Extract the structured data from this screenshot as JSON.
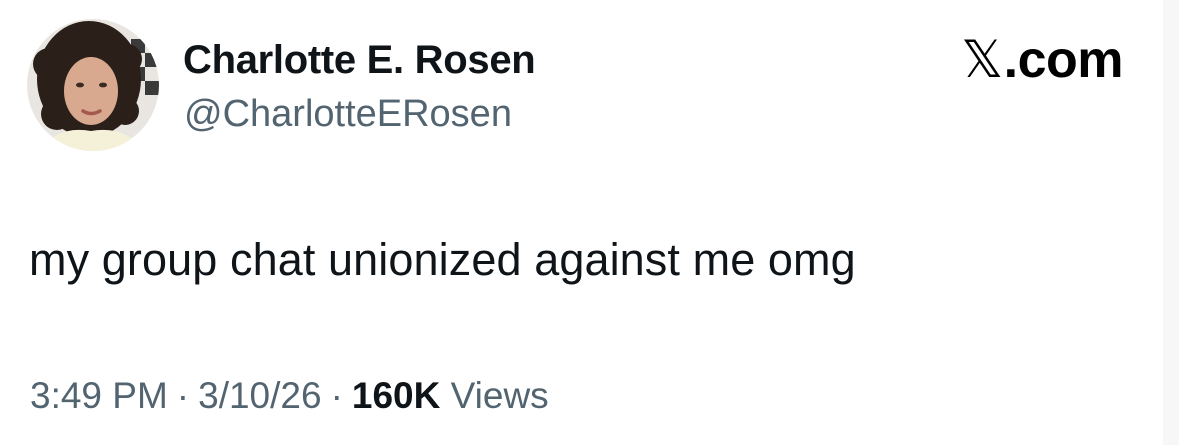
{
  "author": {
    "display_name": "Charlotte E. Rosen",
    "handle": "@CharlotteERosen"
  },
  "brand": {
    "glyph": "𝕏",
    "suffix": ".com"
  },
  "tweet": {
    "text": "my group chat unionized against me omg"
  },
  "meta": {
    "time": "3:49 PM",
    "separator": "·",
    "date": "3/10/26",
    "views_count": "160K",
    "views_label": "Views"
  },
  "colors": {
    "text_primary": "#0f1419",
    "text_secondary": "#536471",
    "background": "#ffffff"
  }
}
